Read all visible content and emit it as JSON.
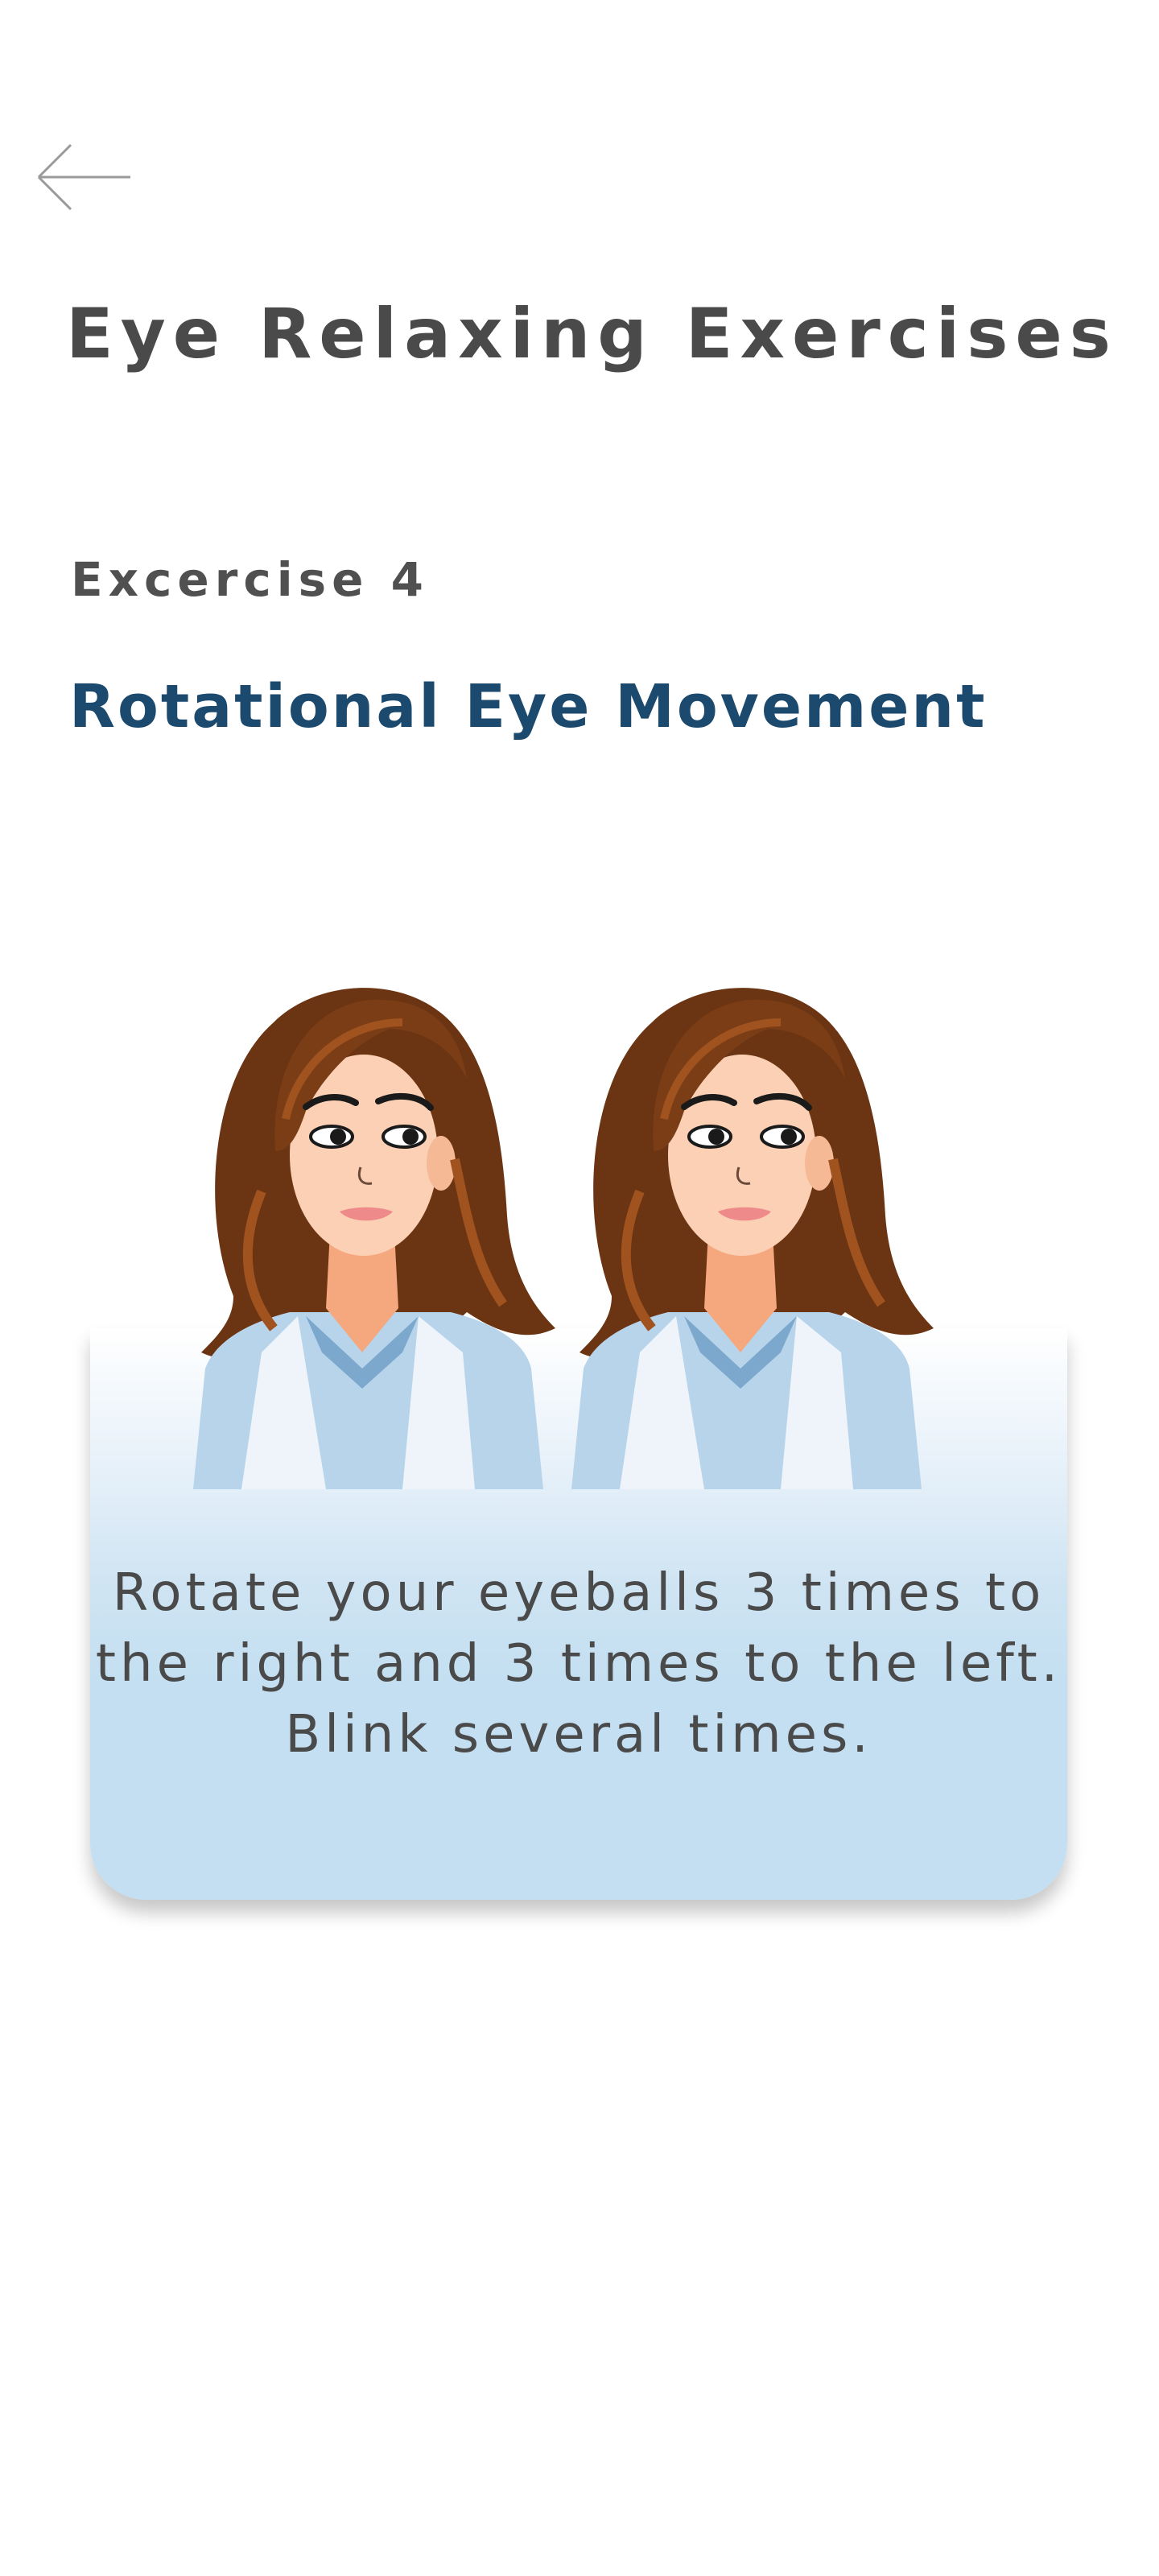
{
  "header": {
    "back_icon": "arrow-left-icon",
    "title": "Eye Relaxing Exercises"
  },
  "exercise": {
    "number_label": "Excercise 4",
    "name": "Rotational Eye Movement",
    "illustration": "two-women-eye-rotation-illustration",
    "instruction": "Rotate your eyeballs 3 times to the right and 3 times to the left. Blink several times."
  },
  "colors": {
    "title": "#4a4a4a",
    "exercise_name": "#1c4a6e",
    "card_bottom": "#c3dff1",
    "hair": "#7a3d15",
    "shirt": "#b8d4eb"
  }
}
